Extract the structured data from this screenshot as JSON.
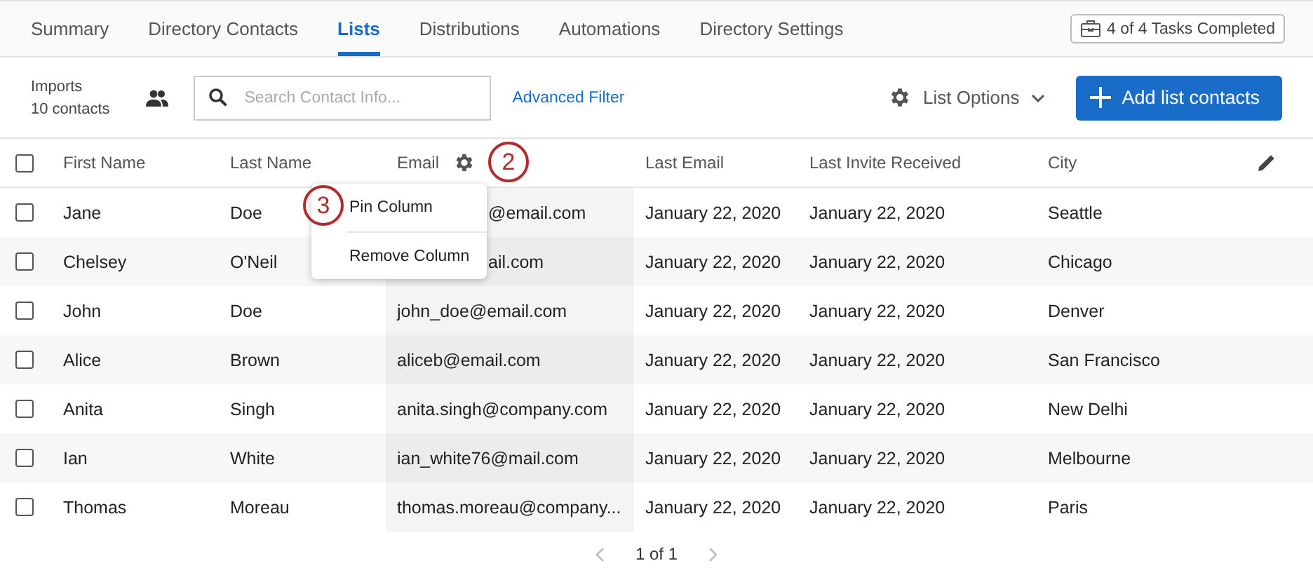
{
  "tabs": [
    {
      "label": "Summary",
      "selected": false
    },
    {
      "label": "Directory Contacts",
      "selected": false
    },
    {
      "label": "Lists",
      "selected": true
    },
    {
      "label": "Distributions",
      "selected": false
    },
    {
      "label": "Automations",
      "selected": false
    },
    {
      "label": "Directory Settings",
      "selected": false
    }
  ],
  "tasks_badge": "4 of 4 Tasks Completed",
  "list_info": {
    "name": "Imports",
    "count": "10 contacts"
  },
  "search": {
    "placeholder": "Search Contact Info..."
  },
  "advanced_filter": "Advanced Filter",
  "list_options": "List Options",
  "add_button": "Add list contacts",
  "select_all": {
    "checked": false
  },
  "columns": [
    "First Name",
    "Last Name",
    "Email",
    "Last Email",
    "Last Invite Received",
    "City"
  ],
  "step_markers": [
    "2",
    "3"
  ],
  "column_menu": [
    "Pin Column",
    "Remove Column"
  ],
  "rows": [
    {
      "checked": false,
      "cells": [
        "Jane",
        "Doe",
        "@email.com",
        "January 22, 2020",
        "January 22, 2020",
        "Seattle"
      ],
      "email_covered": true
    },
    {
      "checked": false,
      "cells": [
        "Chelsey",
        "O'Neil",
        "ail.com",
        "January 22, 2020",
        "January 22, 2020",
        "Chicago"
      ],
      "email_covered": true
    },
    {
      "checked": false,
      "cells": [
        "John",
        "Doe",
        "john_doe@email.com",
        "January 22, 2020",
        "January 22, 2020",
        "Denver"
      ],
      "email_covered": false
    },
    {
      "checked": false,
      "cells": [
        "Alice",
        "Brown",
        "aliceb@email.com",
        "January 22, 2020",
        "January 22, 2020",
        "San Francisco"
      ],
      "email_covered": false
    },
    {
      "checked": false,
      "cells": [
        "Anita",
        "Singh",
        "anita.singh@company.com",
        "January 22, 2020",
        "January 22, 2020",
        "New Delhi"
      ],
      "email_covered": false
    },
    {
      "checked": false,
      "cells": [
        "Ian",
        "White",
        "ian_white76@mail.com",
        "January 22, 2020",
        "January 22, 2020",
        "Melbourne"
      ],
      "email_covered": false
    },
    {
      "checked": false,
      "cells": [
        "Thomas",
        "Moreau",
        "thomas.moreau@company...",
        "January 22, 2020",
        "January 22, 2020",
        "Paris"
      ],
      "email_covered": false
    }
  ],
  "pagination": "1 of 1"
}
